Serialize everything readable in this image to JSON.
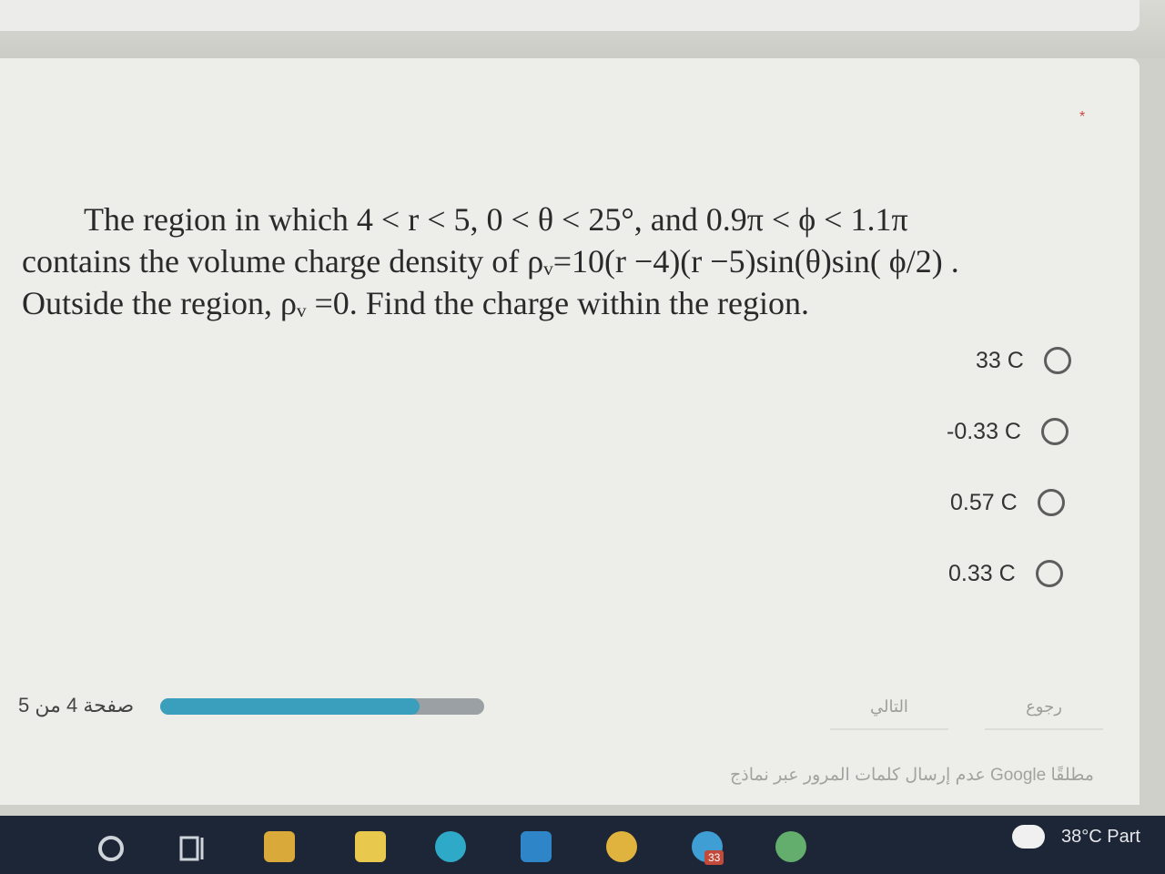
{
  "question": {
    "line1": "The region in which 4 < r < 5, 0 < θ < 25°, and 0.9π < ϕ < 1.1π",
    "line2": "contains the volume charge density of ρᵥ=10(r −4)(r −5)sin(θ)sin( ϕ/2) .",
    "line3": "Outside the region, ρᵥ =0. Find the charge within the region.",
    "required_marker": "*"
  },
  "options": [
    {
      "label": "33 C",
      "selected": false
    },
    {
      "label": "-0.33 C",
      "selected": false
    },
    {
      "label": "0.57 C",
      "selected": false
    },
    {
      "label": "0.33 C",
      "selected": false
    }
  ],
  "navigation": {
    "page_indicator": "صفحة 4 من 5",
    "progress_fraction": 0.8,
    "next_label": "التالي",
    "back_label": "رجوع"
  },
  "footer": {
    "password_notice": "عدم إرسال كلمات المرور عبر نماذج Google مطلقًا"
  },
  "taskbar": {
    "weather_text": "38°C  Part",
    "badge_count": "33"
  },
  "colors": {
    "progress_fill": "#3a9fbd",
    "taskbar": "#1d2637",
    "required": "#c9483c"
  }
}
